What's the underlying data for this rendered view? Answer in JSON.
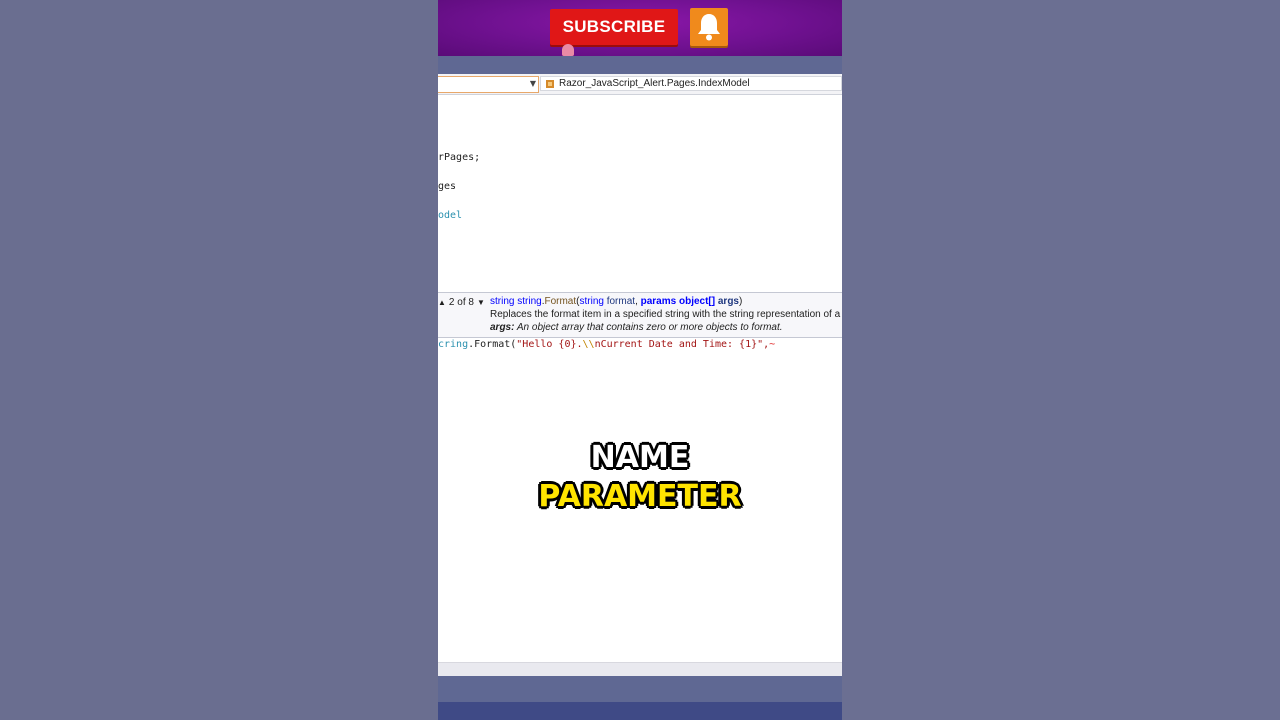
{
  "overlay": {
    "subscribe_label": "SUBSCRIBE",
    "bell_icon": "bell-icon",
    "caption_line1": "NAME",
    "caption_line2": "PARAMETER"
  },
  "editor": {
    "nav_member": "Razor_JavaScript_Alert.Pages.IndexModel",
    "code_lines": [
      "rPages;",
      "ges",
      "odel"
    ],
    "signature": {
      "counter": "2 of 8",
      "return_type": "string",
      "owner_type": "string",
      "method_name": "Format",
      "param1_type": "string",
      "param1_name": "format",
      "params_keyword": "params",
      "param2_type": "object[]",
      "param2_name": "args",
      "description": "Replaces the format item in a specified string with the string representation of a cor",
      "param_help_name": "args:",
      "param_help_text": "An object array that contains zero or more objects to format."
    },
    "current_line": {
      "prefix": "cring",
      "method": ".Format(",
      "string_part1": "\"Hello {0}.",
      "escape": "\\\\",
      "string_part2": "nCurrent Date and Time: {1}\",",
      "squiggle": "~"
    }
  },
  "colors": {
    "banner_purple": "#7a139a",
    "subscribe_red": "#e01717",
    "bell_orange": "#f08a1c",
    "caption_yellow": "#ffe400",
    "background": "#6b6f91"
  }
}
